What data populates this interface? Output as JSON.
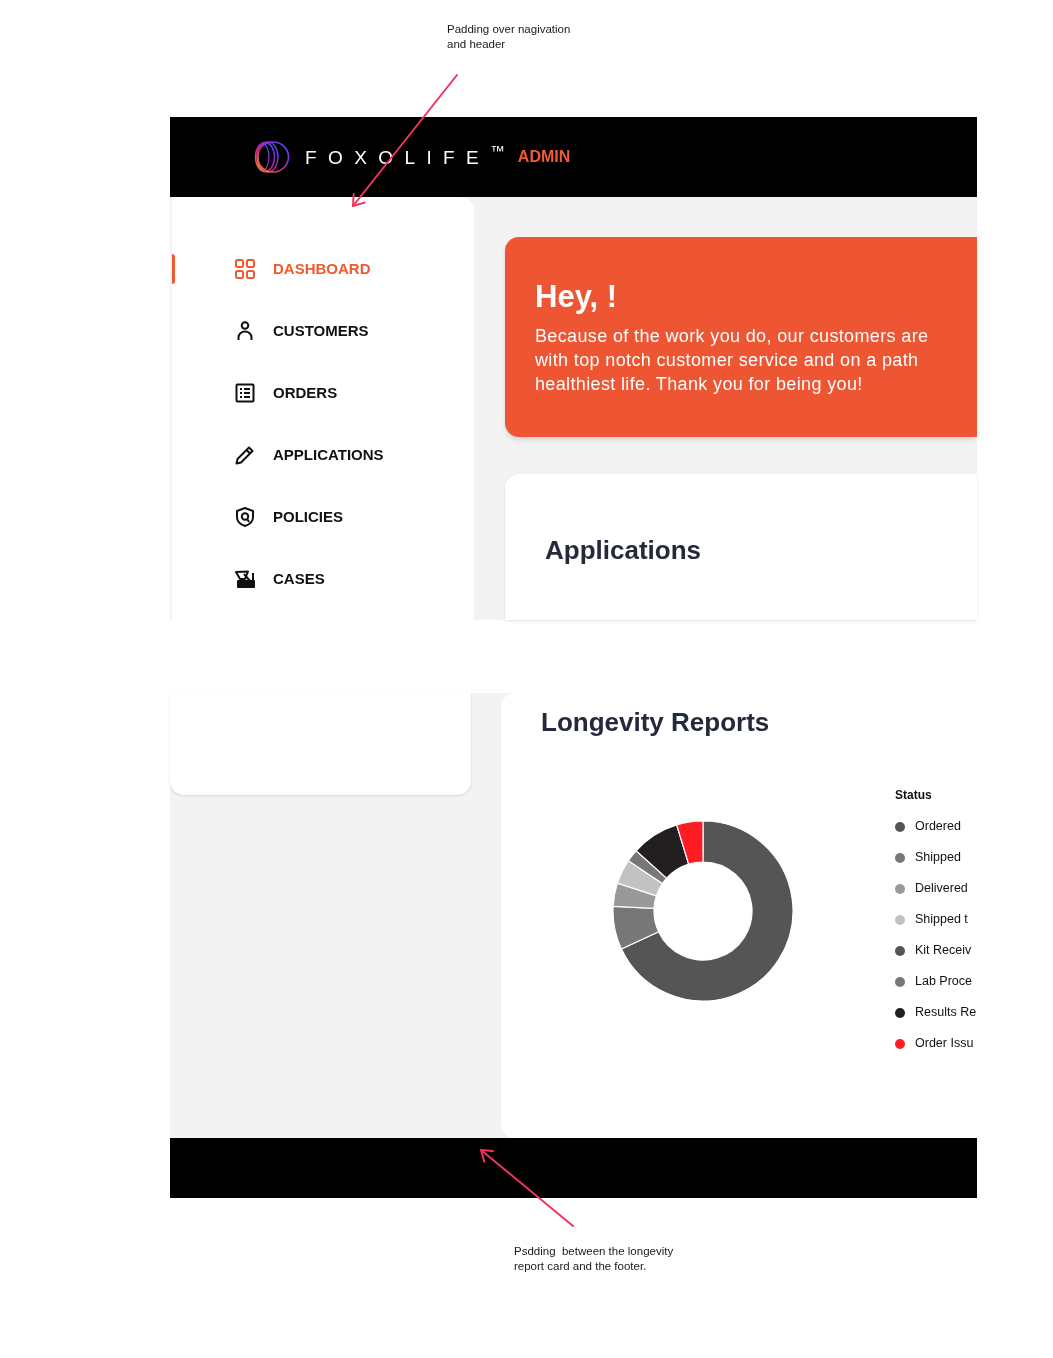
{
  "annotations": [
    {
      "text": "Padding over nagivation and header"
    },
    {
      "text": "Psdding  between the longevity report card and the footer."
    }
  ],
  "header": {
    "brand": "FOXOLIFE$^{™}$",
    "badge": "ADMIN"
  },
  "sidebar": {
    "items": [
      {
        "label": "DASHBOARD",
        "selected": true
      },
      {
        "label": "CUSTOMERS",
        "selected": false
      },
      {
        "label": "ORDERS",
        "selected": false
      },
      {
        "label": "APPLICATIONS",
        "selected": false
      },
      {
        "label": "POLICIES",
        "selected": false
      },
      {
        "label": "CASES",
        "selected": false
      }
    ]
  },
  "hero": {
    "title": "Hey, !",
    "message_lines": [
      "Because of the work you do, our customers are",
      "with top notch customer service and on a path",
      "healthiest life. Thank you for being you!"
    ]
  },
  "applications_card": {
    "title": "Applications"
  },
  "longevity_card": {
    "title": "Longevity Reports",
    "legend": {
      "title": "Status",
      "items": [
        {
          "label": "Ordered",
          "color": "#555555"
        },
        {
          "label": "Shipped",
          "color": "#777777"
        },
        {
          "label": "Delivered",
          "color": "#999999"
        },
        {
          "label": "Shipped t",
          "color": "#c2c2c2"
        },
        {
          "label": "Kit Receiv",
          "color": "#555555"
        },
        {
          "label": "Lab Proce",
          "color": "#777777"
        },
        {
          "label": "Results Re",
          "color": "#231f20"
        },
        {
          "label": "Order Issu",
          "color": "#ff1c23"
        }
      ]
    }
  }
}
